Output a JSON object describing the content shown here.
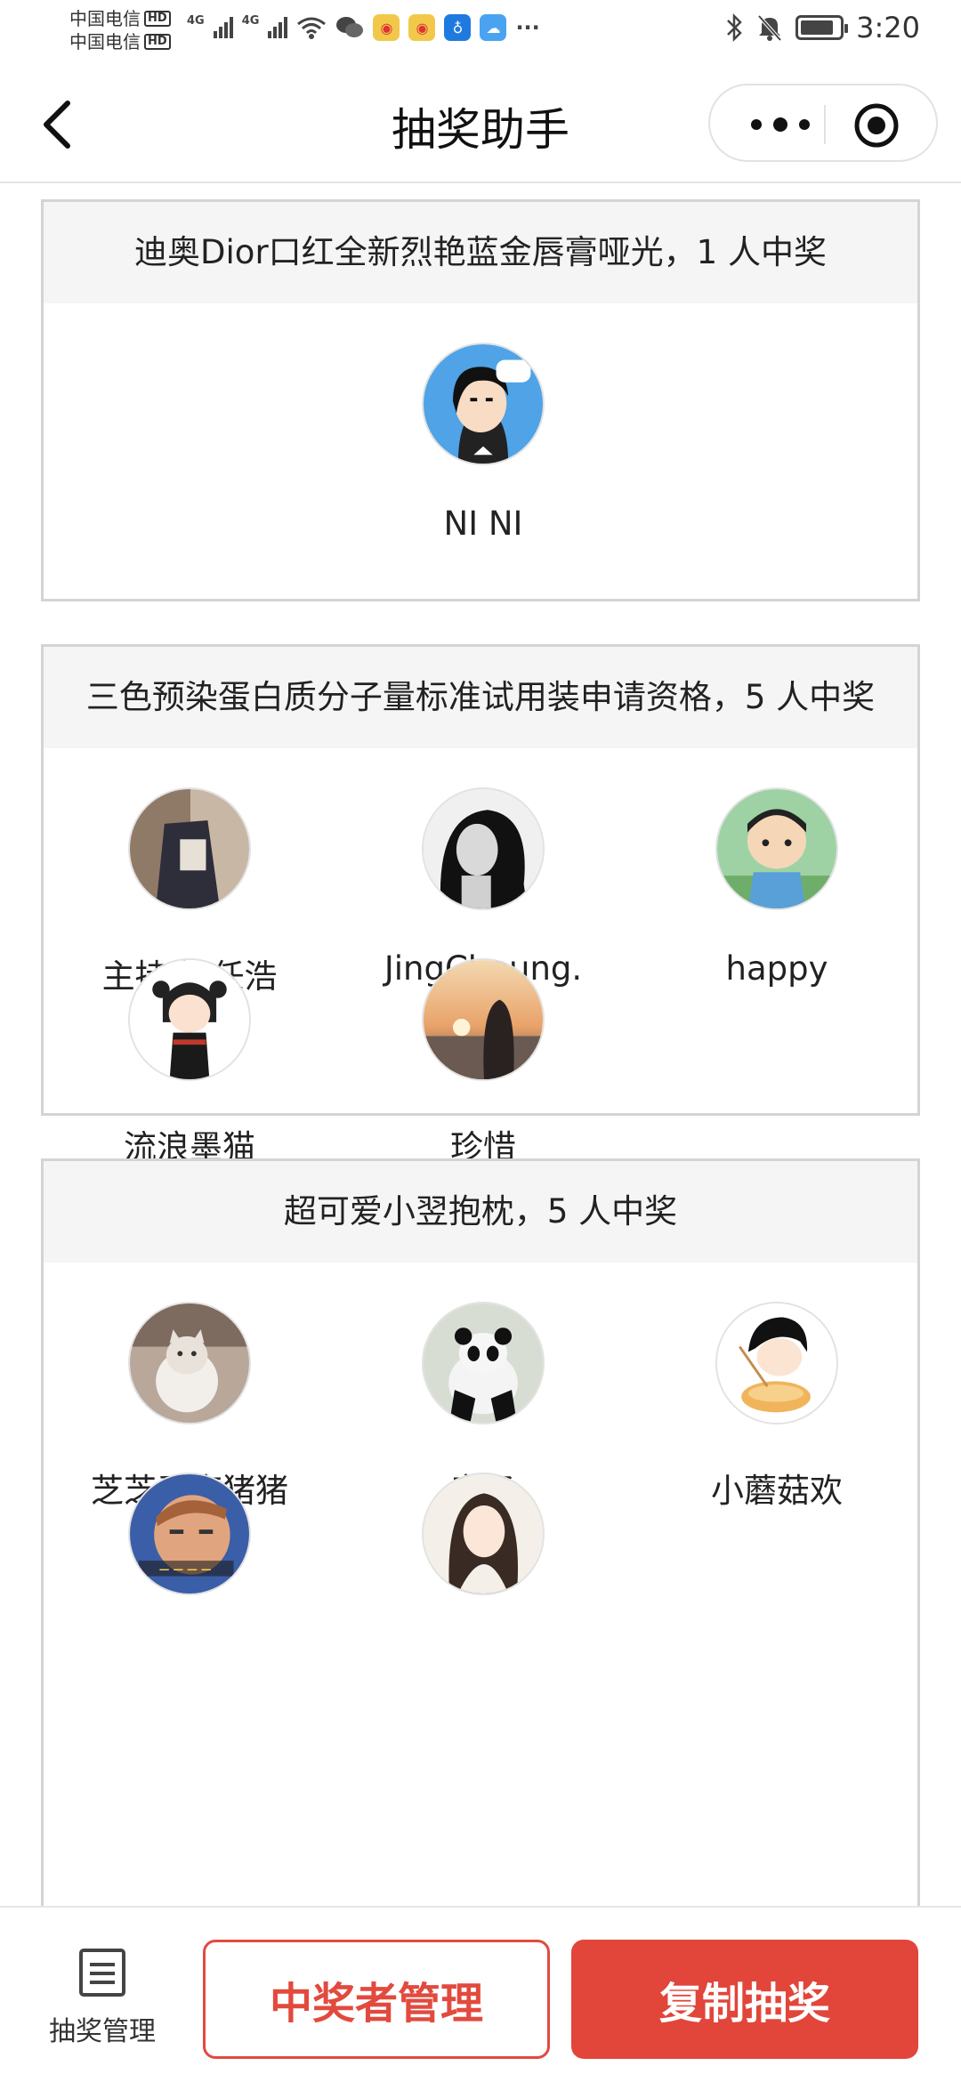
{
  "status_bar": {
    "carrier_1": "中国电信",
    "carrier_2": "中国电信",
    "hd_badge": "HD",
    "network_1": "4G",
    "network_2": "4G",
    "more": "···",
    "time": "3:20"
  },
  "nav": {
    "title": "抽奖助手"
  },
  "prizes": [
    {
      "title": "迪奥Dior口红全新烈艳蓝金唇膏哑光，1 人中奖",
      "winners": [
        {
          "name": "NI NI"
        }
      ]
    },
    {
      "title": "三色预染蛋白质分子量标准试用装申请资格，5 人中奖",
      "winners": [
        {
          "name": "主持人 任浩"
        },
        {
          "name": "JingCheung."
        },
        {
          "name": "happy"
        },
        {
          "name": "流浪墨猫"
        },
        {
          "name": "珍惜"
        }
      ]
    },
    {
      "title": "超可爱小翌抱枕，5 人中奖",
      "winners": [
        {
          "name": "芝芝爱南猪猪"
        },
        {
          "name": "彦子"
        },
        {
          "name": "小蘑菇欢"
        },
        {
          "name": ""
        },
        {
          "name": ""
        }
      ]
    }
  ],
  "bottom_bar": {
    "lottery_management": "抽奖管理",
    "winner_management": "中奖者管理",
    "copy_lottery": "复制抽奖"
  },
  "colors": {
    "accent_red": "#e2453a",
    "header_bg": "#f5f5f5",
    "card_border": "#d4d4d4"
  }
}
